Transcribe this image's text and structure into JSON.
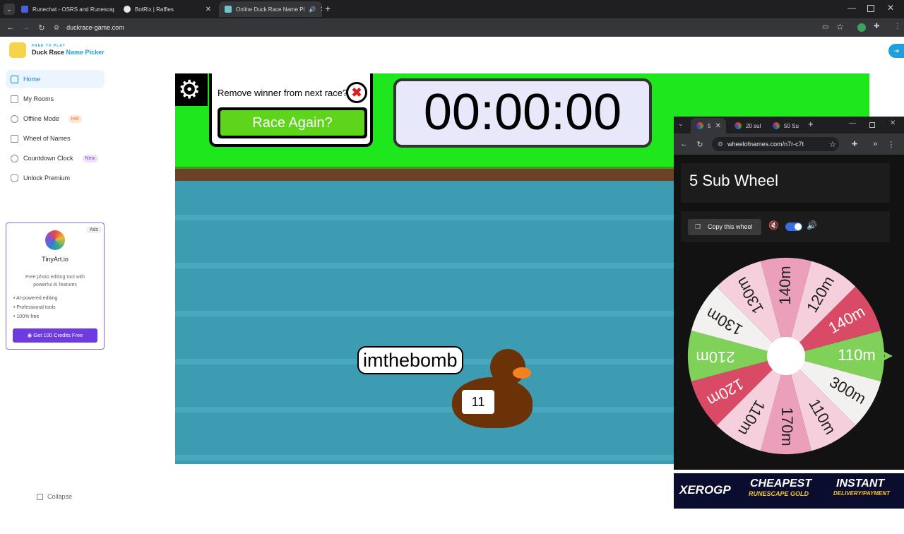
{
  "browser": {
    "tabs": [
      {
        "label": "Runechat - OSRS and Runescap"
      },
      {
        "label": "BotRix | Raffles"
      },
      {
        "label": "Online Duck Race Name Pi"
      }
    ],
    "url": "duckrace-game.com"
  },
  "site": {
    "tagline": "FREE TO PLAY",
    "brand_main": "Duck Race",
    "brand_accent": "Name Picker"
  },
  "nav": {
    "items": [
      {
        "label": "Home"
      },
      {
        "label": "My Rooms"
      },
      {
        "label": "Offline Mode",
        "badge": "Hot"
      },
      {
        "label": "Wheel of Names"
      },
      {
        "label": "Countdown Clock",
        "badge": "New"
      },
      {
        "label": "Unlock Premium"
      }
    ],
    "collapse": "Collapse"
  },
  "ad": {
    "tag": "Ads",
    "name": "TinyArt.io",
    "desc": "Free photo editing tool with powerful AI features",
    "features": [
      "AI-powered editing",
      "Professional tools",
      "100% free"
    ],
    "cta": "Get 100 Credits Free"
  },
  "game": {
    "prompt": "Remove winner from next race?",
    "race_again": "Race Again?",
    "timer": "00:00:00",
    "duck_name": "imthebomb",
    "duck_number": "11"
  },
  "popup": {
    "tabs": [
      {
        "label": "5"
      },
      {
        "label": "20 sul"
      },
      {
        "label": "50 Su"
      }
    ],
    "url": "wheelofnames.com/n7r-c7t",
    "title": "5 Sub Wheel",
    "copy": "Copy this wheel",
    "wheel": {
      "segments": [
        {
          "label": "110m",
          "color": "#7fd15a"
        },
        {
          "label": "300m",
          "color": "#f3f0f0"
        },
        {
          "label": "110m",
          "color": "#f6cfdc"
        },
        {
          "label": "170m",
          "color": "#ec9fbb"
        },
        {
          "label": "110m",
          "color": "#f6cfdc"
        },
        {
          "label": "120m",
          "color": "#d94a66"
        },
        {
          "label": "210m",
          "color": "#7fd15a"
        },
        {
          "label": "130m",
          "color": "#f3f0f0"
        },
        {
          "label": "130m",
          "color": "#f6cfdc"
        },
        {
          "label": "140m",
          "color": "#ec9fbb"
        },
        {
          "label": "120m",
          "color": "#f6cfdc"
        },
        {
          "label": "140m",
          "color": "#d94a66"
        }
      ]
    }
  },
  "banner": {
    "brand": "XEROGP",
    "line1a": "CHEAPEST",
    "line1b": "RUNESCAPE GOLD",
    "line2a": "INSTANT",
    "line2b": "DELIVERY/PAYMENT"
  }
}
